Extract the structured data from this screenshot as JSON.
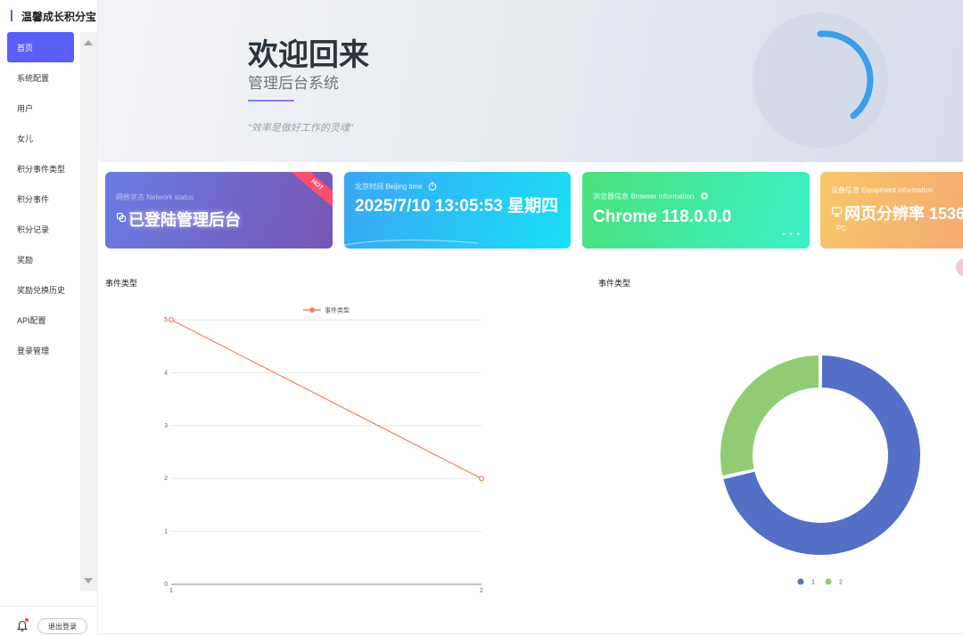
{
  "brand": {
    "title": "温馨成长积分宝"
  },
  "sidebar": {
    "items": [
      {
        "label": "首页",
        "active": true
      },
      {
        "label": "系统配置"
      },
      {
        "label": "用户"
      },
      {
        "label": "女儿"
      },
      {
        "label": "积分事件类型"
      },
      {
        "label": "积分事件"
      },
      {
        "label": "积分记录"
      },
      {
        "label": "奖励"
      },
      {
        "label": "奖励兑换历史"
      },
      {
        "label": "API配置"
      },
      {
        "label": "登录管理"
      }
    ],
    "logout_label": "退出登录"
  },
  "hero": {
    "title": "欢迎回来",
    "subtitle": "管理后台系统",
    "quote": "\"效率是做好工作的灵魂\""
  },
  "cards": {
    "network": {
      "label": "网络状态 Network status",
      "value": "已登陆管理后台",
      "ribbon": "HOT"
    },
    "time": {
      "label": "北京时间 Beijing time",
      "value": "2025/7/10 13:05:53 星期四"
    },
    "browser": {
      "label": "浏览器信息 Browser information",
      "value": "Chrome 118.0.0.0"
    },
    "device": {
      "label": "设备信息 Equipment information",
      "value": "网页分辨率 1536",
      "sub": "PC"
    }
  },
  "charts": {
    "line_title": "事件类型",
    "pie_title": "事件类型"
  },
  "colors": {
    "accent": "#5b5ef7",
    "line": "#f6835a",
    "pie_1": "#5470c6",
    "pie_2": "#91cc75"
  },
  "chart_data": [
    {
      "type": "line",
      "title": "事件类型",
      "x": [
        "1",
        "2"
      ],
      "series": [
        {
          "name": "事件类型",
          "values": [
            5,
            2
          ]
        }
      ],
      "ylim": [
        0,
        5
      ],
      "yticks": [
        0,
        1,
        2,
        3,
        4,
        5
      ],
      "grid": true,
      "legend": "top-center"
    },
    {
      "type": "pie",
      "title": "事件类型",
      "labels": [
        "1",
        "2"
      ],
      "values": [
        5,
        2
      ],
      "donut": true,
      "legend": "bottom-center"
    }
  ]
}
